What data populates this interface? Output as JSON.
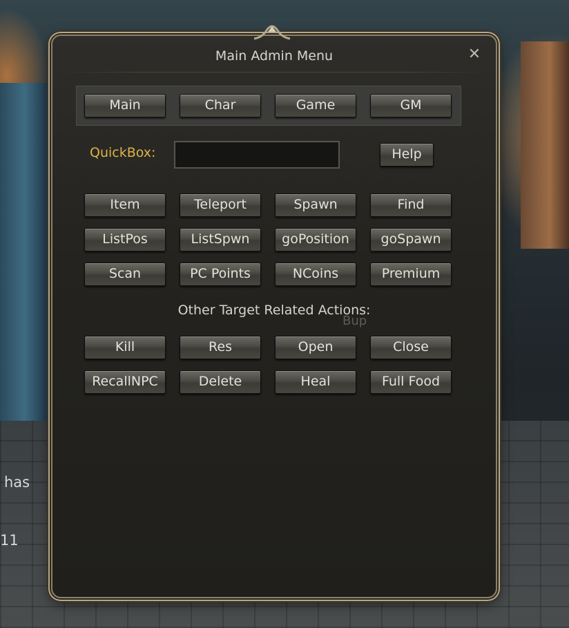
{
  "window": {
    "title": "Main Admin Menu",
    "close_glyph": "✕"
  },
  "tabs": [
    "Main",
    "Char",
    "Game",
    "GM"
  ],
  "quickbox": {
    "label": "QuickBox:",
    "value": "",
    "help_label": "Help"
  },
  "commands": [
    [
      "Item",
      "Teleport",
      "Spawn",
      "Find"
    ],
    [
      "ListPos",
      "ListSpwn",
      "goPosition",
      "goSpawn"
    ],
    [
      "Scan",
      "PC Points",
      "NCoins",
      "Premium"
    ]
  ],
  "target_section": {
    "label": "Other Target Related Actions:",
    "actions": [
      [
        "Kill",
        "Res",
        "Open",
        "Close"
      ],
      [
        "RecallNPC",
        "Delete",
        "Heal",
        "Full Food"
      ]
    ]
  },
  "background_text": {
    "chat_fragment_1": "has",
    "chat_fragment_2": "11",
    "overlay_fragment": "Bup"
  },
  "colors": {
    "accent_label": "#e0b248",
    "frame": "#b5a888",
    "panel": "#24231f"
  }
}
